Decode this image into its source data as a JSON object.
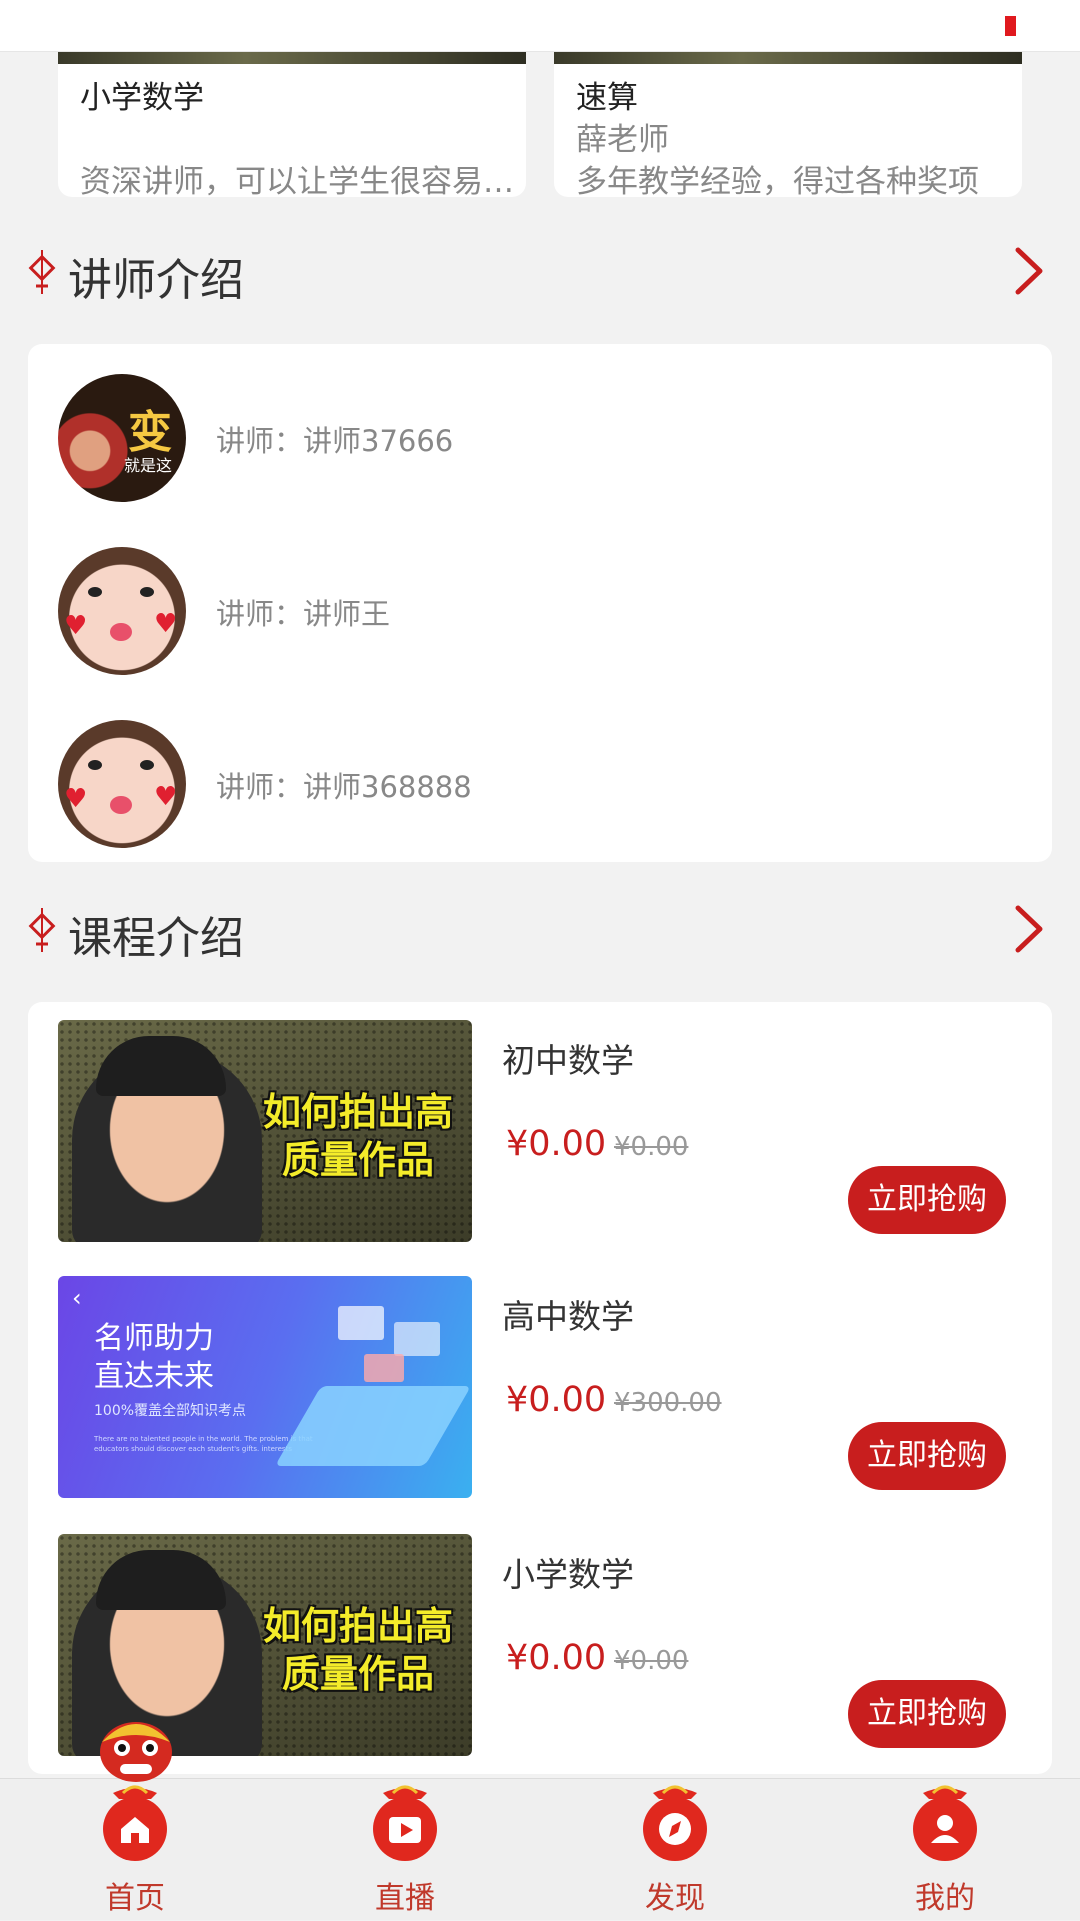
{
  "top_cards": [
    {
      "title": "小学数学",
      "subtitle": "",
      "desc": "资深讲师，可以让学生很容易…"
    },
    {
      "title": "速算",
      "subtitle": "薛老师",
      "desc": "多年教学经验，得过各种奖项"
    }
  ],
  "teachers_section": {
    "title": "讲师介绍"
  },
  "teachers": [
    {
      "label": "讲师：讲师37666",
      "avatar_text_1": "变",
      "avatar_text_2": "就是这"
    },
    {
      "label": "讲师：讲师王"
    },
    {
      "label": "讲师：讲师368888"
    }
  ],
  "courses_section": {
    "title": "课程介绍"
  },
  "courses": [
    {
      "title": "初中数学",
      "price": "¥0.00",
      "old_price": "¥0.00",
      "button": "立即抢购",
      "thumb_headline": "如何拍出高质量作品"
    },
    {
      "title": "高中数学",
      "price": "¥0.00",
      "old_price": "¥300.00",
      "button": "立即抢购",
      "thumb_headline_1": "名师助力",
      "thumb_headline_2": "直达未来",
      "thumb_sub": "100%覆盖全部知识考点",
      "thumb_small": "There are no talented people in the world. The problem is that educators should discover each student's gifts. interests"
    },
    {
      "title": "小学数学",
      "price": "¥0.00",
      "old_price": "¥0.00",
      "button": "立即抢购",
      "thumb_headline": "如何拍出高质量作品"
    }
  ],
  "nav": [
    {
      "label": "首页",
      "icon": "home-icon"
    },
    {
      "label": "直播",
      "icon": "live-icon"
    },
    {
      "label": "发现",
      "icon": "compass-icon"
    },
    {
      "label": "我的",
      "icon": "user-icon"
    }
  ],
  "colors": {
    "accent": "#c81e1e",
    "nav_label": "#c0392b",
    "background": "#f2f2f2"
  }
}
